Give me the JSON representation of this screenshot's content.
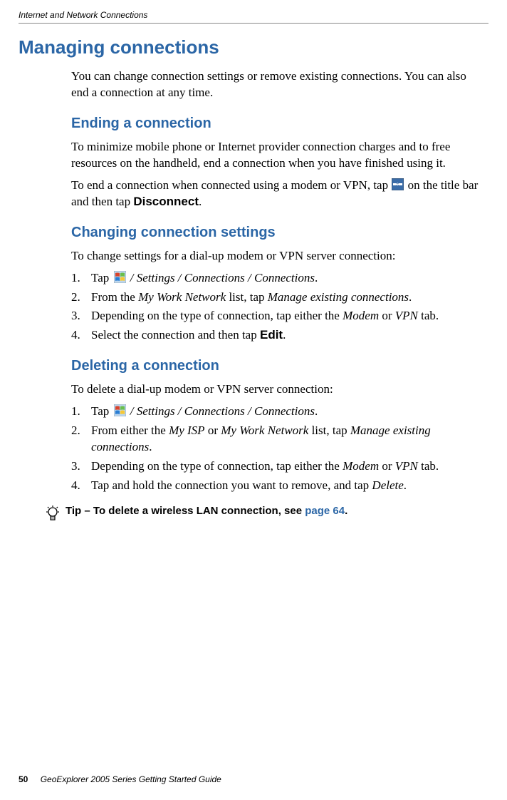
{
  "header": "Internet and Network Connections",
  "mainTitle": "Managing connections",
  "intro": "You can change connection settings or remove existing connections. You can also end a connection at any time.",
  "sections": {
    "ending": {
      "title": "Ending a connection",
      "p1": "To minimize mobile phone or Internet provider connection charges and to free resources on the handheld, end a connection when you have finished using it.",
      "p2a": "To end a connection when connected using a modem or VPN, tap ",
      "p2b": " on the title bar and then tap ",
      "disconnect": "Disconnect",
      "dot": "."
    },
    "changing": {
      "title": "Changing connection settings",
      "lead": "To change settings for a dial-up modem or VPN server connection:",
      "step1": {
        "num": "1.",
        "pre": "Tap ",
        "path": " / Settings / Connections / Connections",
        "dot": "."
      },
      "step2": {
        "num": "2.",
        "t1": "From the ",
        "i1": "My Work Network",
        "t2": " list, tap ",
        "i2": "Manage existing connections",
        "dot": "."
      },
      "step3": {
        "num": "3.",
        "t1": "Depending on the type of connection, tap either the ",
        "i1": "Modem",
        "t2": " or ",
        "i2": "VPN",
        "t3": " tab."
      },
      "step4": {
        "num": "4.",
        "t1": "Select the connection and then tap ",
        "b": "Edit",
        "dot": "."
      }
    },
    "deleting": {
      "title": "Deleting a connection",
      "lead": "To delete a dial-up modem or VPN server connection:",
      "step1": {
        "num": "1.",
        "pre": "Tap ",
        "path": " / Settings / Connections / Connections",
        "dot": "."
      },
      "step2": {
        "num": "2.",
        "t1": "From either the ",
        "i1": "My ISP",
        "t2": " or ",
        "i3": "My Work Network",
        "t3": " list, tap ",
        "i2": "Manage existing connections",
        "dot": "."
      },
      "step3": {
        "num": "3.",
        "t1": "Depending on the type of connection, tap either the ",
        "i1": "Modem",
        "t2": " or ",
        "i2": "VPN",
        "t3": " tab."
      },
      "step4": {
        "num": "4.",
        "t1": "Tap and hold the connection you want to remove, and tap ",
        "i1": "Delete",
        "dot": "."
      }
    }
  },
  "tip": {
    "label": "Tip – ",
    "text": "To delete a wireless LAN connection, see ",
    "link": "page 64",
    "dot": "."
  },
  "footer": {
    "pageNum": "50",
    "title": "GeoExplorer 2005 Series Getting Started Guide"
  }
}
